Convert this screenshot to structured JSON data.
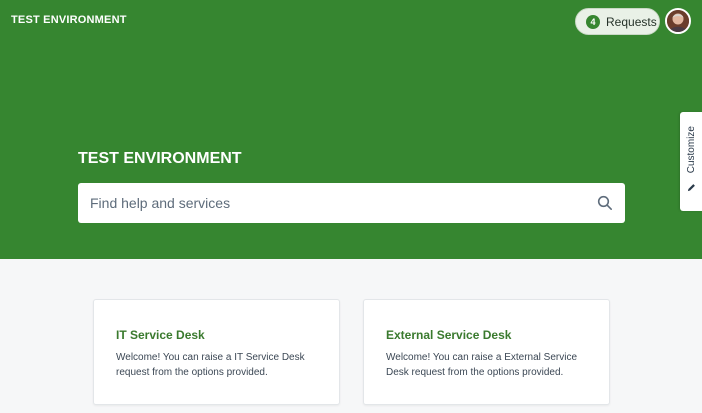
{
  "header": {
    "brand": "TEST ENVIRONMENT",
    "requests": {
      "count": "4",
      "label": "Requests"
    }
  },
  "hero": {
    "title": "TEST ENVIRONMENT",
    "search": {
      "placeholder": "Find help and services",
      "value": ""
    }
  },
  "customize": {
    "label": "Customize"
  },
  "cards": [
    {
      "title": "IT Service Desk",
      "description": "Welcome! You can raise a IT Service Desk request from the options provided."
    },
    {
      "title": "External Service Desk",
      "description": "Welcome! You can raise a External Service Desk request from the options provided."
    }
  ],
  "colors": {
    "brand_green": "#368630",
    "card_title": "#3a7a2e",
    "page_bg": "#f6f7f8"
  },
  "icons": {
    "search": "search-icon",
    "customize": "pencil-icon",
    "avatar": "avatar"
  }
}
